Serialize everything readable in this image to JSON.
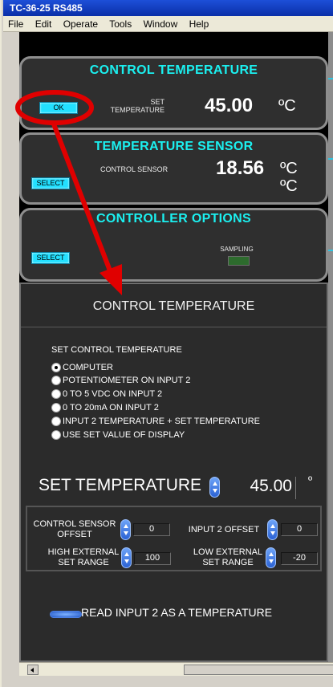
{
  "window": {
    "title": "TC-36-25 RS485",
    "menu": [
      "File",
      "Edit",
      "Operate",
      "Tools",
      "Window",
      "Help"
    ]
  },
  "control_temperature_panel": {
    "title": "CONTROL TEMPERATURE",
    "button_label": "OK",
    "set_label": "SET TEMPERATURE",
    "value": "45.00",
    "unit": "ºC"
  },
  "temperature_sensor_panel": {
    "title": "TEMPERATURE SENSOR",
    "button_label": "SELECT",
    "sensor_label": "CONTROL SENSOR",
    "value": "18.56",
    "unit": "ºC",
    "unit2": "ºC"
  },
  "controller_options_panel": {
    "title": "CONTROLLER OPTIONS",
    "button_label": "SELECT",
    "sampling_label": "SAMPLING"
  },
  "control_temperature_dialog": {
    "title": "CONTROL TEMPERATURE",
    "section_label": "SET CONTROL TEMPERATURE",
    "options": [
      "COMPUTER",
      "POTENTIOMETER ON INPUT 2",
      "0 TO 5 VDC ON INPUT 2",
      "0 TO 20mA ON INPUT 2",
      "INPUT 2 TEMPERATURE + SET TEMPERATURE",
      "USE SET VALUE OF DISPLAY"
    ],
    "selected_option": "COMPUTER",
    "set_temperature_label": "SET TEMPERATURE",
    "set_temperature_value": "45.00",
    "set_temperature_unit": "º",
    "control_sensor_offset_label": "CONTROL SENSOR OFFSET",
    "control_sensor_offset_value": "0",
    "input2_offset_label": "INPUT 2 OFFSET",
    "input2_offset_value": "0",
    "high_external_label": "HIGH EXTERNAL SET RANGE",
    "high_external_value": "100",
    "low_external_label": "LOW EXTERNAL SET RANGE",
    "low_external_value": "-20",
    "read_input_label": "READ INPUT 2 AS A TEMPERATURE"
  },
  "colors": {
    "accent_cyan": "#1bf0f0",
    "annotation_red": "#e00000",
    "panel_bg": "#2f2f2f"
  }
}
